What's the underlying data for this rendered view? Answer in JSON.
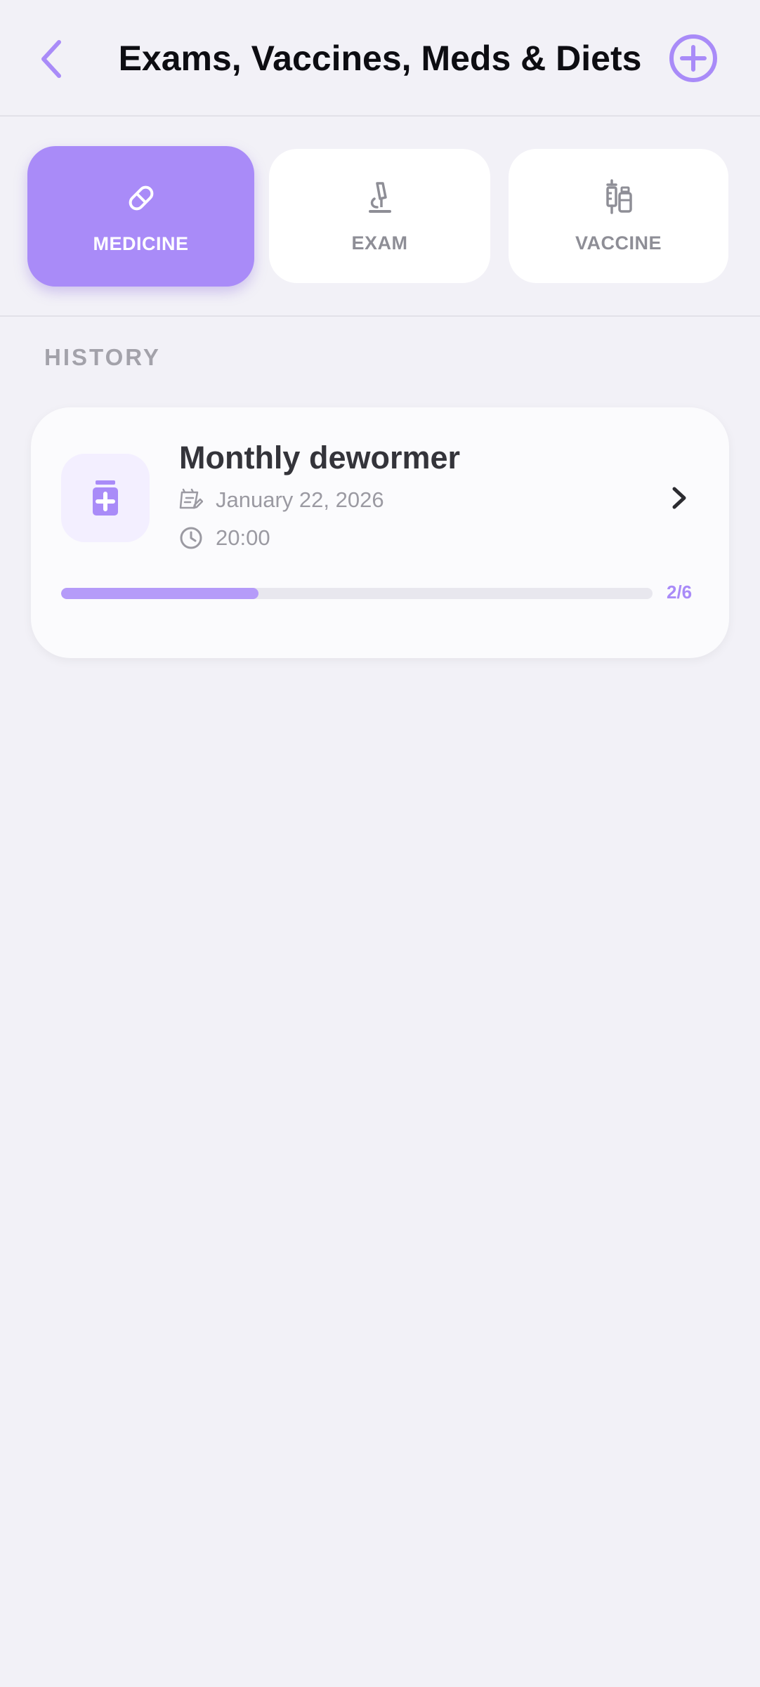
{
  "header": {
    "title": "Exams, Vaccines, Meds & Diets",
    "back_icon": "chevron-left-icon",
    "add_icon": "plus-circle-icon",
    "accent_color": "#a98bf8"
  },
  "tabs": [
    {
      "label": "MEDICINE",
      "icon": "pill-icon",
      "active": true
    },
    {
      "label": "EXAM",
      "icon": "microscope-icon",
      "active": false
    },
    {
      "label": "VACCINE",
      "icon": "syringe-vial-icon",
      "active": false
    }
  ],
  "history": {
    "section_label": "HISTORY",
    "items": [
      {
        "title": "Monthly dewormer",
        "date": "January 22, 2026",
        "time": "20:00",
        "icon": "medicine-bottle-icon",
        "progress_done": 2,
        "progress_total": 6,
        "progress_label": "2/6"
      }
    ]
  }
}
